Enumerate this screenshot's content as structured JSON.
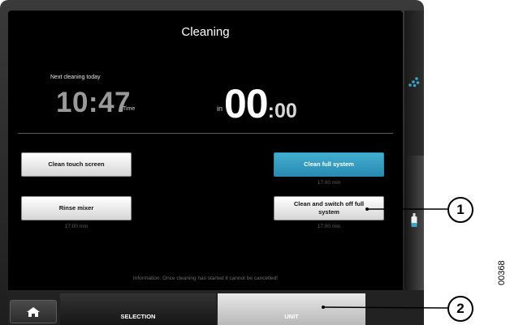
{
  "screen": {
    "title": "Cleaning",
    "next_label": "Next cleaning today",
    "next_time": "10:47",
    "time_unit": "Time",
    "in_label": "in",
    "countdown_big": "00",
    "countdown_small": ":00"
  },
  "buttons": [
    {
      "label": "Clean touch screen",
      "caption": "",
      "active": false
    },
    {
      "label": "Clean full system",
      "caption": "17:00 min",
      "active": true
    },
    {
      "label": "Rinse mixer",
      "caption": "17:00 min",
      "active": false
    },
    {
      "label": "Clean and switch off full system",
      "caption": "17:00 min",
      "active": false
    }
  ],
  "info_text": "Information: Once cleaning has started it cannot be cancelled!",
  "bottombar": {
    "home_icon": "home-icon",
    "tab_selection": "SELECTION",
    "tab_unit": "UNIT"
  },
  "side_icons": [
    "water-drops-icon",
    "bottle-icon"
  ],
  "callouts": [
    "1",
    "2"
  ],
  "figure_code": "00368",
  "colors": {
    "accent": "#2a9bc4",
    "screen_bg": "#000000"
  }
}
